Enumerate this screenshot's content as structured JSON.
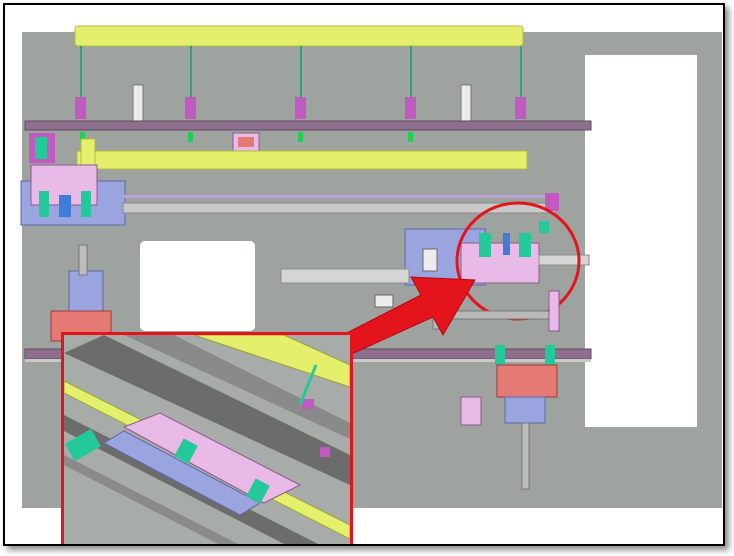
{
  "figure": {
    "background_color": "#ffffff",
    "machine_body_color": "#9ea3a0",
    "highlight_color": "#e3141b",
    "rail_color": "#e4f06c",
    "mount_color": "#c05ac0",
    "clamp_color": "#e9b9e7",
    "base_color": "#9aa5e0",
    "pad_color": "#e57a74",
    "gripper_color": "#24c99a"
  },
  "callout": {
    "shape": "circle",
    "arrow_icon": "right-arrow-icon"
  },
  "inset": {
    "view": "perspective-closeup",
    "icon": "gripper-detail-icon"
  }
}
